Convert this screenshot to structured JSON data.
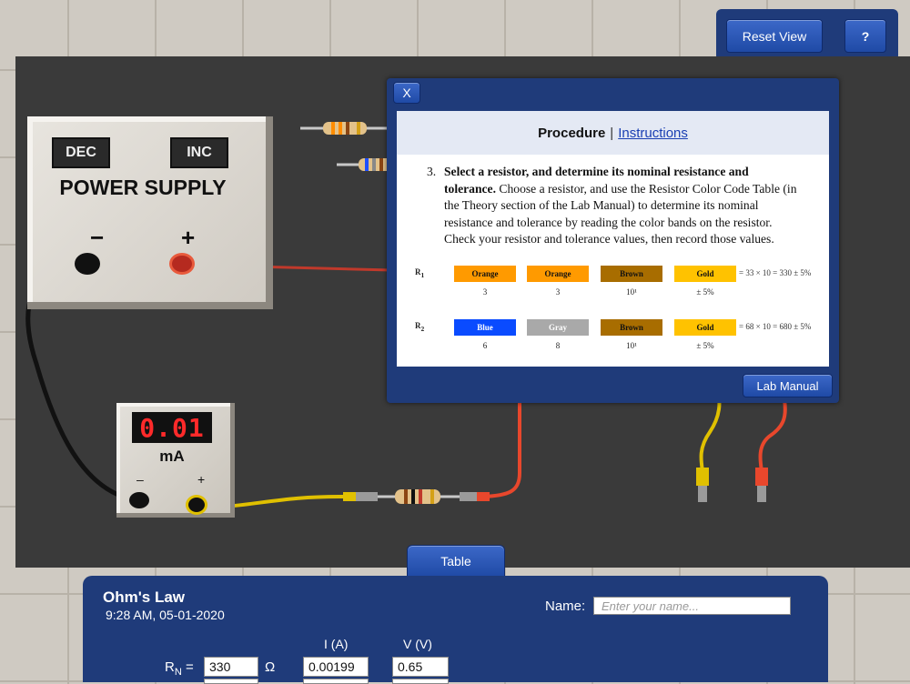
{
  "toolbar": {
    "reset_label": "Reset View",
    "help_label": "?"
  },
  "power_supply": {
    "dec_label": "DEC",
    "inc_label": "INC",
    "title": "POWER SUPPLY",
    "minus_label": "−",
    "plus_label": "+"
  },
  "ammeter": {
    "reading": "0.01",
    "unit": "mA",
    "minus_label": "–",
    "plus_label": "+"
  },
  "dialog": {
    "close_label": "X",
    "tab_active": "Procedure",
    "separator": "|",
    "tab_link": "Instructions",
    "step_number": "3.",
    "step_bold": "Select a resistor, and determine its nominal resistance and tolerance.",
    "step_text": "Choose a resistor, and use the Resistor Color Code Table (in the Theory section of the Lab Manual) to determine its nominal resistance and tolerance by reading the color bands on the resistor. Check your resistor and tolerance values, then record those values.",
    "resistors": [
      {
        "label": "R",
        "sub": "1",
        "bands": [
          {
            "name": "Orange",
            "color": "#ff9a00",
            "text_color": "#111",
            "digit": "3"
          },
          {
            "name": "Orange",
            "color": "#ff9a00",
            "text_color": "#111",
            "digit": "3"
          },
          {
            "name": "Brown",
            "color": "#a86d00",
            "text_color": "#111",
            "digit": "10¹"
          },
          {
            "name": "Gold",
            "color": "#ffc200",
            "text_color": "#111",
            "digit": "± 5%"
          }
        ],
        "equation": "= 33 × 10 = 330 ± 5%"
      },
      {
        "label": "R",
        "sub": "2",
        "bands": [
          {
            "name": "Blue",
            "color": "#0a4bff",
            "text_color": "#fff",
            "digit": "6"
          },
          {
            "name": "Gray",
            "color": "#a9a9a9",
            "text_color": "#fff",
            "digit": "8"
          },
          {
            "name": "Brown",
            "color": "#a86d00",
            "text_color": "#111",
            "digit": "10¹"
          },
          {
            "name": "Gold",
            "color": "#ffc200",
            "text_color": "#111",
            "digit": "± 5%"
          }
        ],
        "equation": "= 68 × 10 = 680 ± 5%"
      }
    ],
    "lab_manual_label": "Lab Manual"
  },
  "data_panel": {
    "tab_label": "Table",
    "title": "Ohm's Law",
    "timestamp": "9:28 AM, 05-01-2020",
    "name_label": "Name:",
    "name_placeholder": "Enter your name...",
    "col_current": "I (A)",
    "col_voltage": "V (V)",
    "rn_label": "R",
    "rn_sub": "N",
    "rn_eq": " =",
    "rn_value": "330",
    "ohm_symbol": "Ω",
    "current_value": "0.00199",
    "voltage_value": "0.65"
  },
  "colors": {
    "accent": "#1f3b7a",
    "button": "#2a55b8",
    "board": "#3a3a3a",
    "lcd": "#ff2a2a"
  }
}
